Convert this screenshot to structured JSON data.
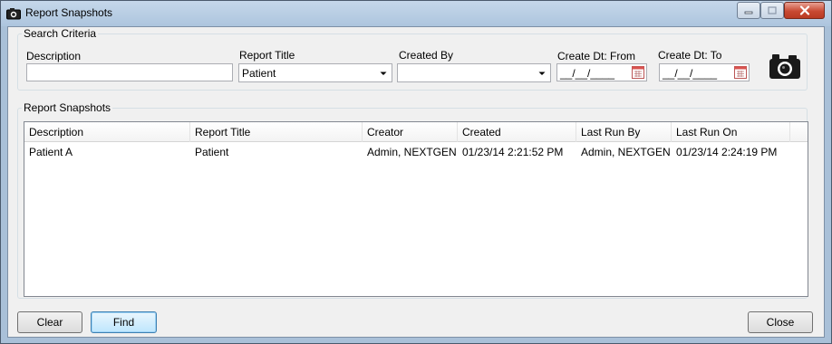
{
  "window": {
    "title": "Report Snapshots",
    "icon": "camera-icon",
    "controls": [
      "minimize-icon",
      "maximize-icon",
      "close-icon"
    ]
  },
  "search": {
    "group_title": "Search Criteria",
    "description_label": "Description",
    "description_value": "",
    "report_title_label": "Report Title",
    "report_title_value": "Patient",
    "created_by_label": "Created By",
    "created_by_value": "",
    "create_from_label": "Create Dt: From",
    "create_from_value": "__/__/____",
    "create_to_label": "Create Dt: To",
    "create_to_value": "__/__/____",
    "snapshot_icon": "camera-icon"
  },
  "results": {
    "group_title": "Report Snapshots",
    "columns": [
      "Description",
      "Report Title",
      "Creator",
      "Created",
      "Last Run By",
      "Last Run On"
    ],
    "rows": [
      [
        "Patient A",
        "Patient",
        "Admin, NEXTGEN",
        "01/23/14  2:21:52 PM",
        "Admin, NEXTGEN",
        "01/23/14  2:24:19 PM"
      ]
    ]
  },
  "buttons": {
    "clear": "Clear",
    "find": "Find",
    "close": "Close"
  },
  "colors": {
    "titlebar": "#adc5de",
    "client_bg": "#f0f0f0",
    "close_button": "#c94a33",
    "focus_border": "#3c7fb1"
  }
}
